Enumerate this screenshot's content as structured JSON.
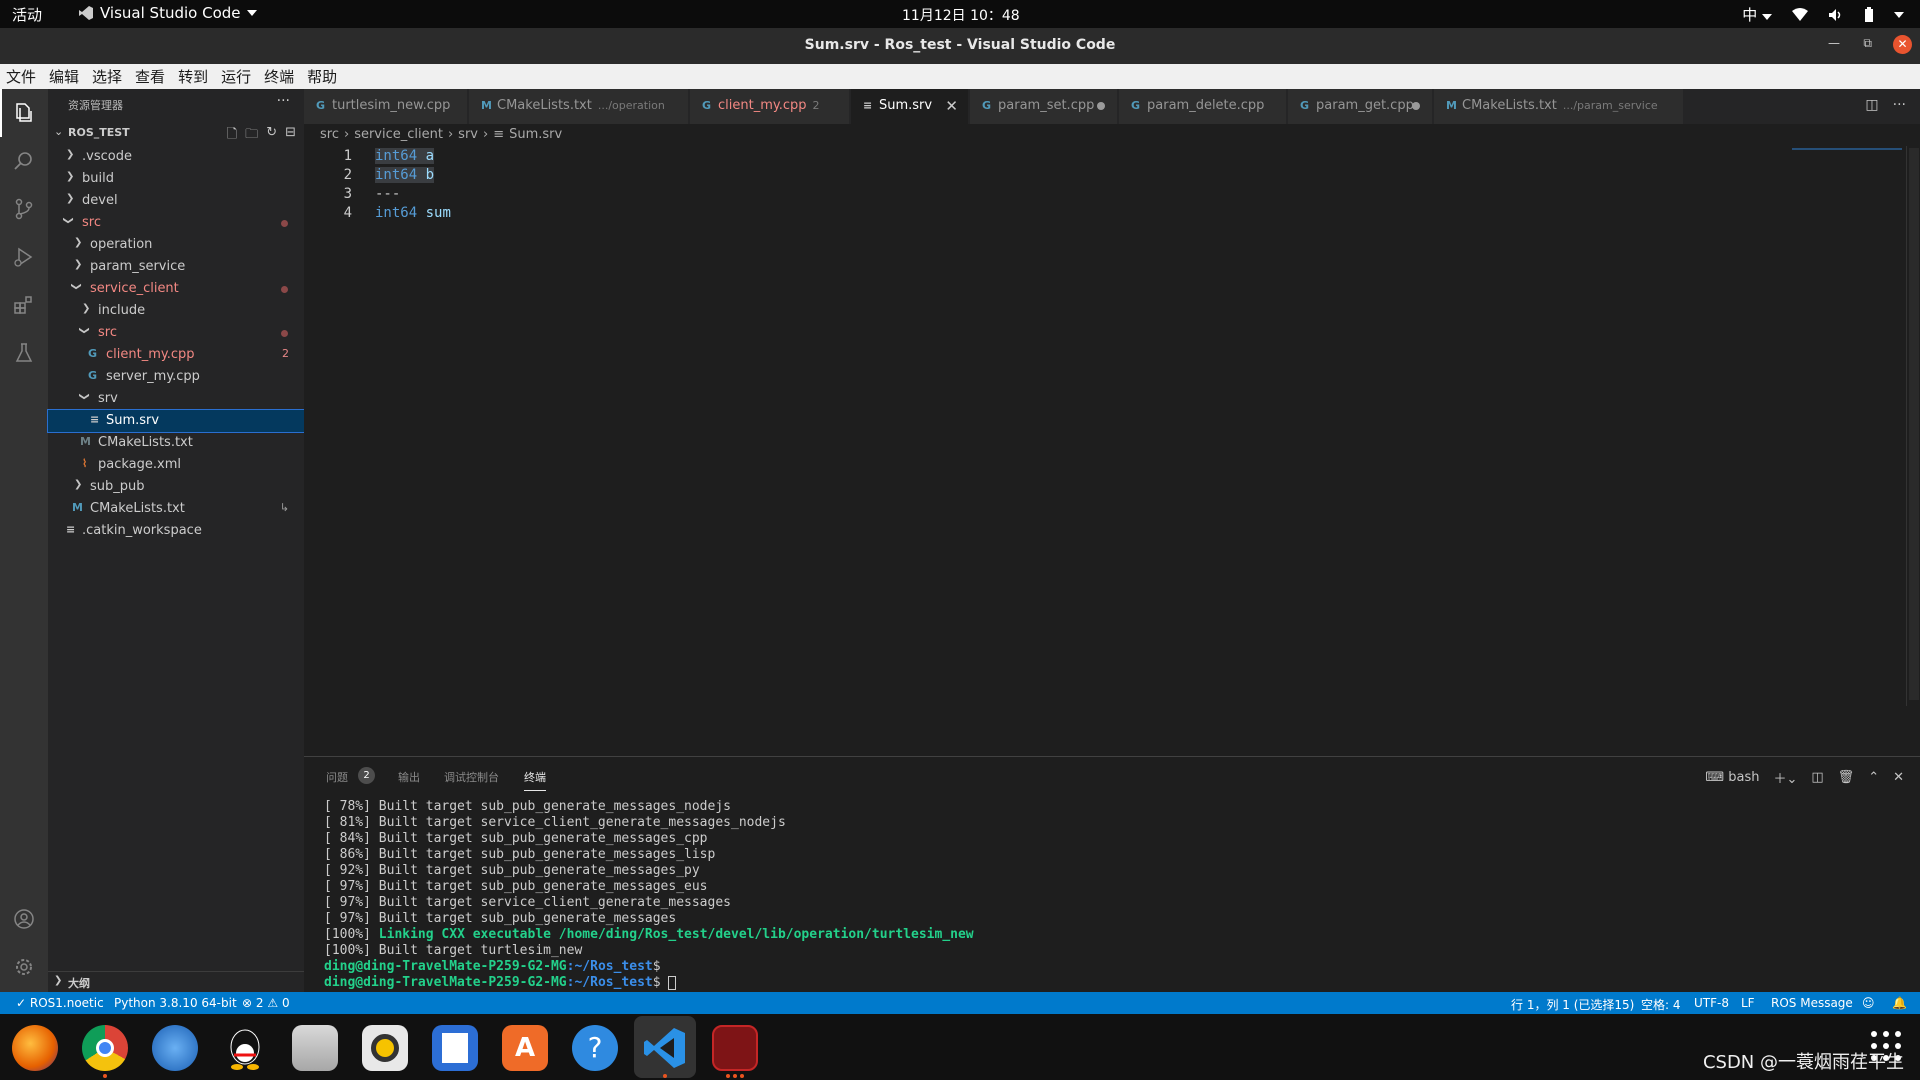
{
  "topbar": {
    "activities": "活动",
    "app_name": "Visual Studio Code",
    "clock": "11月12日  10：48",
    "input_method": "中"
  },
  "window": {
    "title": "Sum.srv - Ros_test - Visual Studio Code"
  },
  "menu": [
    "文件",
    "编辑",
    "选择",
    "查看",
    "转到",
    "运行",
    "终端",
    "帮助"
  ],
  "sidebar": {
    "title": "资源管理器",
    "root": "ROS_TEST",
    "items": [
      {
        "label": ".vscode"
      },
      {
        "label": "build"
      },
      {
        "label": "devel"
      },
      {
        "label": "src"
      },
      {
        "label": "operation"
      },
      {
        "label": "param_service"
      },
      {
        "label": "service_client"
      },
      {
        "label": "include"
      },
      {
        "label": "src"
      },
      {
        "label": "client_my.cpp",
        "count": "2"
      },
      {
        "label": "server_my.cpp"
      },
      {
        "label": "srv"
      },
      {
        "label": "Sum.srv"
      },
      {
        "label": "CMakeLists.txt"
      },
      {
        "label": "package.xml"
      },
      {
        "label": "sub_pub"
      },
      {
        "label": "CMakeLists.txt"
      },
      {
        "label": ".catkin_workspace"
      }
    ],
    "outline": "大纲"
  },
  "tabs": [
    {
      "label": "turtlesim_new.cpp",
      "desc": ""
    },
    {
      "label": "CMakeLists.txt",
      "desc": ".../operation"
    },
    {
      "label": "client_my.cpp",
      "desc": "2"
    },
    {
      "label": "Sum.srv",
      "desc": ""
    },
    {
      "label": "param_set.cpp",
      "desc": ""
    },
    {
      "label": "param_delete.cpp",
      "desc": ""
    },
    {
      "label": "param_get.cpp",
      "desc": ""
    },
    {
      "label": "CMakeLists.txt",
      "desc": ".../param_service"
    }
  ],
  "breadcrumb": [
    "src",
    "service_client",
    "srv",
    "Sum.srv"
  ],
  "editor": {
    "lines": [
      {
        "n": "1",
        "type": "int64",
        "name": "a"
      },
      {
        "n": "2",
        "type": "int64",
        "name": "b"
      },
      {
        "n": "3",
        "text": "---"
      },
      {
        "n": "4",
        "type": "int64",
        "name": "sum"
      }
    ]
  },
  "panel": {
    "tabs": [
      "问题",
      "输出",
      "调试控制台",
      "终端"
    ],
    "problems_count": "2",
    "shell": "bash",
    "terminal_lines": [
      "[ 78%] Built target sub_pub_generate_messages_nodejs",
      "[ 81%] Built target service_client_generate_messages_nodejs",
      "[ 84%] Built target sub_pub_generate_messages_cpp",
      "[ 86%] Built target sub_pub_generate_messages_lisp",
      "[ 92%] Built target sub_pub_generate_messages_py",
      "[ 97%] Built target sub_pub_generate_messages_eus",
      "[ 97%] Built target service_client_generate_messages",
      "[ 97%] Built target sub_pub_generate_messages"
    ],
    "link_prefix": "[100%] ",
    "link_text": "Linking CXX executable /home/ding/Ros_test/devel/lib/operation/turtlesim_new",
    "built_line": "[100%] Built target turtlesim_new",
    "prompt_user": "ding@ding-TravelMate-P259-G2-MG",
    "prompt_path": ":~/Ros_test",
    "prompt_end": "$"
  },
  "statusbar": {
    "ros": "ROS1.noetic",
    "python": "Python 3.8.10 64-bit",
    "errors": "2",
    "warnings": "0",
    "position": "行 1，列 1 (已选择15)",
    "spaces": "空格: 4",
    "encoding": "UTF-8",
    "eol": "LF",
    "language": "ROS Message"
  },
  "watermark": "CSDN @一蓑烟雨荏平生",
  "colors": {
    "accent": "#007acc",
    "modified": "#f38883",
    "keyword": "#569cd6"
  }
}
